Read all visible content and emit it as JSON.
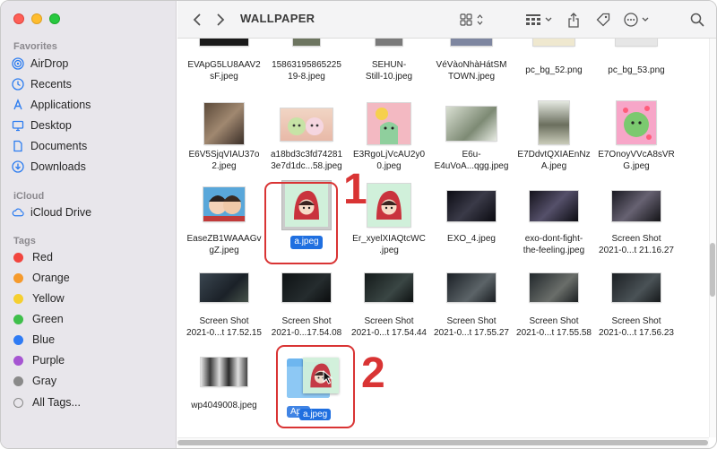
{
  "window": {
    "title": "WALLPAPER"
  },
  "sidebar": {
    "favorites_title": "Favorites",
    "favorites": [
      {
        "label": "AirDrop",
        "icon": "airdrop-icon"
      },
      {
        "label": "Recents",
        "icon": "clock-icon"
      },
      {
        "label": "Applications",
        "icon": "applications-icon"
      },
      {
        "label": "Desktop",
        "icon": "desktop-icon"
      },
      {
        "label": "Documents",
        "icon": "document-icon"
      },
      {
        "label": "Downloads",
        "icon": "download-icon"
      }
    ],
    "icloud_title": "iCloud",
    "icloud": [
      {
        "label": "iCloud Drive",
        "icon": "cloud-icon"
      }
    ],
    "tags_title": "Tags",
    "tags": [
      {
        "label": "Red",
        "color": "#f1453e"
      },
      {
        "label": "Orange",
        "color": "#f59a2c"
      },
      {
        "label": "Yellow",
        "color": "#f5cf30"
      },
      {
        "label": "Green",
        "color": "#3fbf4b"
      },
      {
        "label": "Blue",
        "color": "#2f7bf4"
      },
      {
        "label": "Purple",
        "color": "#a655d2"
      },
      {
        "label": "Gray",
        "color": "#8a8a8a"
      },
      {
        "label": "All Tags...",
        "color": ""
      }
    ]
  },
  "files": {
    "row0": [
      "EVApG5LU8AAV2\nsF.jpeg",
      "15863195865225\n19-8.jpeg",
      "SEHUN-\nStill-10.jpeg",
      "VéVàoNhàHátSM\nTOWN.jpeg",
      "pc_bg_52.png",
      "pc_bg_53.png"
    ],
    "row1": [
      "E6V5SjqVIAU37o\n2.jpeg",
      "a18bd3c3fd74281\n3e7d1dc...58.jpeg",
      "E3RgoLjVcAU2y0\n0.jpeg",
      "E6u-\nE4uVoA...qgg.jpeg",
      "E7DdvtQXIAEnNz\nA.jpeg",
      "E7OnoyVVcA8sVR\nG.jpeg"
    ],
    "row2": [
      "EaseZB1WAAAGv\ngZ.jpeg",
      "a.jpeg",
      "Er_xyelXIAQtcWC\n.jpeg",
      "EXO_4.jpeg",
      "exo-dont-fight-\nthe-feeling.jpeg",
      "Screen Shot\n2021-0...t 21.16.27"
    ],
    "row3": [
      "Screen Shot\n2021-0...t 17.52.15",
      "Screen Shot\n2021-0...17.54.08",
      "Screen Shot\n2021-0...t 17.54.44",
      "Screen Shot\n2021-0...t 17.55.27",
      "Screen Shot\n2021-0...t 17.55.58",
      "Screen Shot\n2021-0...t 17.56.23"
    ],
    "row4": [
      "wp4049008.jpeg"
    ],
    "drag_folder_label": "App",
    "drag_file_label": "a.jpeg"
  },
  "annotations": {
    "one": "1",
    "two": "2"
  }
}
